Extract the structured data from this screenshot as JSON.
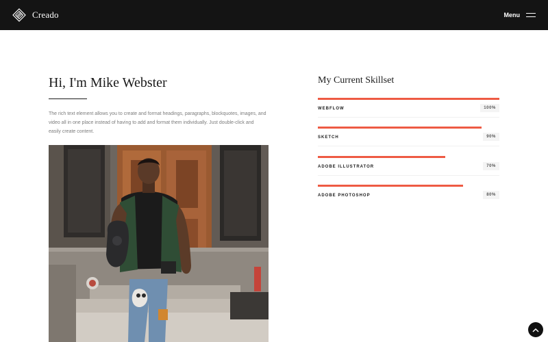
{
  "navbar": {
    "brand_name": "Creado",
    "menu_label": "Menu",
    "icons": {
      "logo": "diamond-logo-icon",
      "menu": "hamburger-icon"
    }
  },
  "intro": {
    "title": "Hi, I'm Mike Webster",
    "paragraph": "The rich text element allows you to create and format headings, paragraphs, blockquotes, images, and video all in one place instead of having to add and format them individually. Just double-click and easily create content."
  },
  "skills": {
    "title": "My Current Skillset",
    "accent_color": "#ee5a43",
    "items": [
      {
        "name": "WEBFLOW",
        "percent_label": "100%",
        "level": 1.0
      },
      {
        "name": "SKETCH",
        "percent_label": "90%",
        "level": 0.9
      },
      {
        "name": "ADOBE ILLUSTRATOR",
        "percent_label": "70%",
        "level": 0.7
      },
      {
        "name": "ADOBE PHOTOSHOP",
        "percent_label": "80%",
        "level": 0.8
      }
    ]
  },
  "back_to_top": {
    "icon": "chevron-up-icon"
  }
}
